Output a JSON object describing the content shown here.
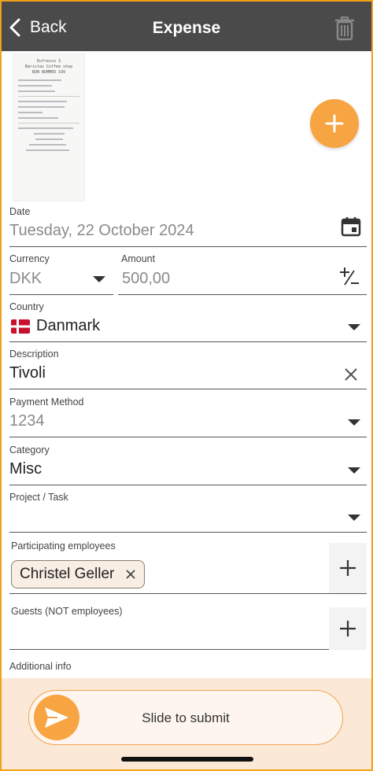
{
  "header": {
    "back_label": "Back",
    "title": "Expense"
  },
  "receipt": {
    "lines": [
      "Eufresco 3",
      "Baristas Coffee shop",
      "BON NUMMER 199"
    ]
  },
  "fields": {
    "date": {
      "label": "Date",
      "value": "Tuesday, 22 October 2024"
    },
    "currency": {
      "label": "Currency",
      "value": "DKK"
    },
    "amount": {
      "label": "Amount",
      "value": "500,00"
    },
    "country": {
      "label": "Country",
      "flag": "🇩🇰",
      "value": "Danmark"
    },
    "description": {
      "label": "Description",
      "value": "Tivoli"
    },
    "payment_method": {
      "label": "Payment Method",
      "value": "1234"
    },
    "category": {
      "label": "Category",
      "value": "Misc"
    },
    "project_task": {
      "label": "Project / Task",
      "value": ""
    },
    "participants": {
      "label": "Participating employees",
      "chips": [
        "Christel Geller"
      ]
    },
    "guests": {
      "label": "Guests (NOT employees)"
    },
    "additional": {
      "label": "Additional info"
    }
  },
  "submit": {
    "label": "Slide to submit"
  },
  "colors": {
    "accent": "#f7a443",
    "header": "#4a4a4a",
    "border": "#f0a21a"
  }
}
